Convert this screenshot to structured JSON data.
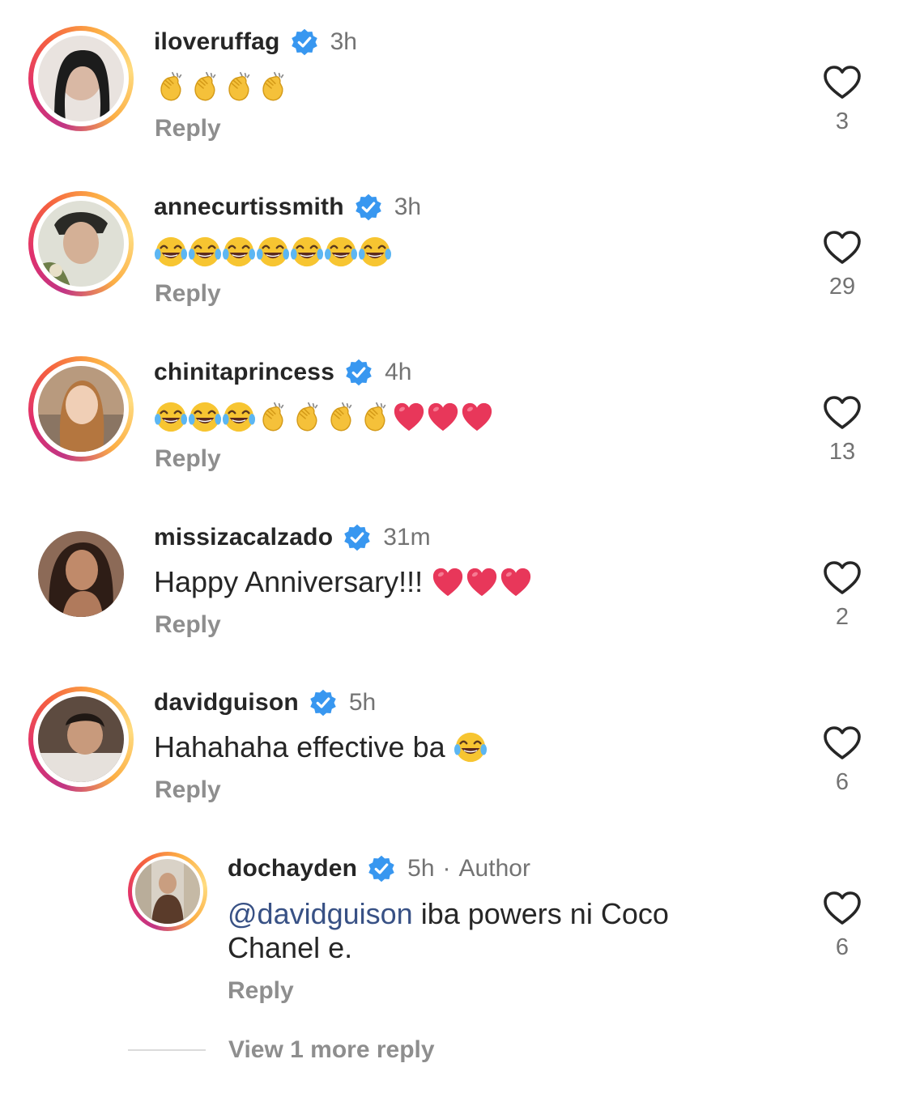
{
  "comments": [
    {
      "username": "iloveruffag",
      "time": "3h",
      "reply": "Reply",
      "likes": "3",
      "emojis": [
        "clap",
        "clap",
        "clap",
        "clap"
      ],
      "ring": true,
      "avatar_color": "#2b2b2b"
    },
    {
      "username": "annecurtissmith",
      "time": "3h",
      "reply": "Reply",
      "likes": "29",
      "emojis": [
        "joy",
        "joy",
        "joy",
        "joy",
        "joy",
        "joy",
        "joy"
      ],
      "ring": true,
      "avatar_color": "#7a7f6e"
    },
    {
      "username": "chinitaprincess",
      "time": "4h",
      "reply": "Reply",
      "likes": "13",
      "emojis": [
        "joy",
        "joy",
        "joy",
        "clap",
        "clap",
        "clap",
        "clap",
        "heart",
        "heart",
        "heart"
      ],
      "ring": true,
      "avatar_color": "#c9a27f"
    },
    {
      "username": "missizacalzado",
      "time": "31m",
      "text": "Happy Anniversary!!!",
      "reply": "Reply",
      "likes": "2",
      "emojis": [
        "heart",
        "heart",
        "heart"
      ],
      "ring": false,
      "avatar_color": "#6a4a3a"
    },
    {
      "username": "davidguison",
      "time": "5h",
      "text": "Hahahaha effective ba",
      "reply": "Reply",
      "likes": "6",
      "emojis": [
        "joy"
      ],
      "ring": true,
      "avatar_color": "#5a4a42"
    }
  ],
  "nested_reply": {
    "username": "dochayden",
    "time": "5h",
    "separator": "·",
    "author_label": "Author",
    "mention": "@davidguison",
    "text_line1": " iba powers ni Coco",
    "text_line2": "Chanel e.",
    "reply": "Reply",
    "likes": "6",
    "ring": true,
    "avatar_color": "#6b4d3a"
  },
  "view_more": "View 1 more reply",
  "colors": {
    "verified": "#3897f0",
    "heart_emoji": "#e8375a",
    "clap": "#f5c13a",
    "joy": "#f7c531"
  }
}
